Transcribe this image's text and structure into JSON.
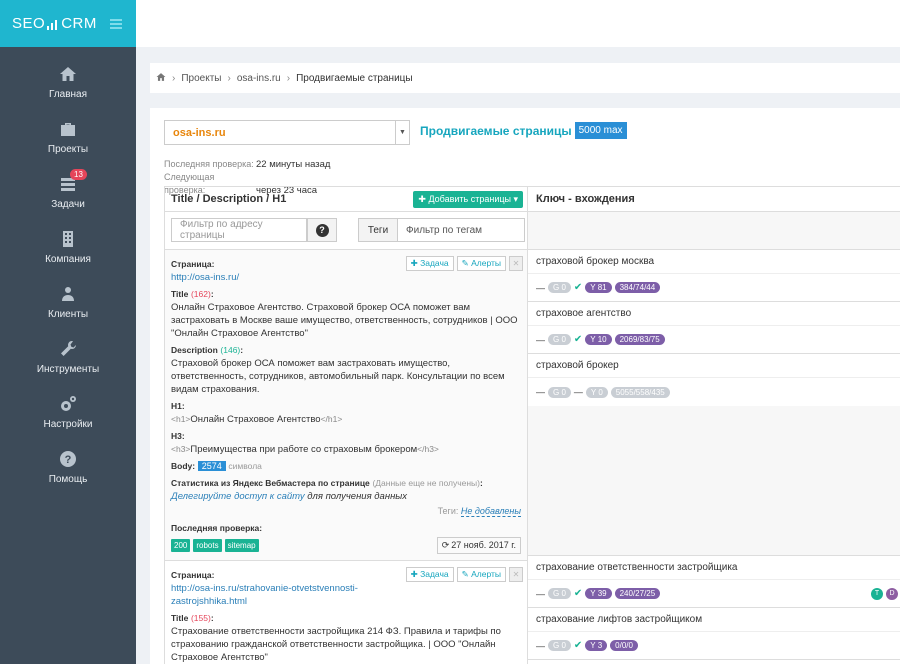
{
  "brand": {
    "logo_left": "SEO",
    "logo_right": "CRM"
  },
  "sidebar": {
    "items": [
      {
        "label": "Главная",
        "icon": "home-icon"
      },
      {
        "label": "Проекты",
        "icon": "briefcase-icon"
      },
      {
        "label": "Задачи",
        "icon": "tasks-icon",
        "badge": "13"
      },
      {
        "label": "Компания",
        "icon": "building-icon"
      },
      {
        "label": "Клиенты",
        "icon": "users-icon"
      },
      {
        "label": "Инструменты",
        "icon": "wrench-icon"
      },
      {
        "label": "Настройки",
        "icon": "gears-icon"
      },
      {
        "label": "Помощь",
        "icon": "question-icon"
      }
    ]
  },
  "breadcrumb": {
    "items": [
      "Проекты",
      "osa-ins.ru",
      "Продвигаемые страницы"
    ]
  },
  "project": {
    "selected": "osa-ins.ru",
    "heading": "Продвигаемые страницы",
    "limit": "5000 max",
    "last_check_label": "Последняя проверка:",
    "last_check_value": "22 минуты назад",
    "next_check_label": "Следующая проверка:",
    "next_check_value": "через 23 часа"
  },
  "left": {
    "header": "Title / Description / H1",
    "add_button": "Добавить страницы",
    "url_filter_placeholder": "Фильтр по адресу страницы",
    "tags_label": "Теги",
    "tags_filter_placeholder": "Фильтр по тегам"
  },
  "actions": {
    "task": "Задача",
    "alerts": "Алерты"
  },
  "page1": {
    "page_label": "Страница:",
    "url": "http://osa-ins.ru/",
    "title_label": "Title",
    "title_count": "(162)",
    "title_text": "Онлайн Страховое Агентство. Страховой брокер ОСА поможет вам застраховать в Москве ваше имущество, ответственность, сотрудников | ООО \"Онлайн Страховое Агентство\"",
    "desc_label": "Description",
    "desc_count": "(146)",
    "desc_text": "Страховой брокер ОСА поможет вам застраховать имущество, ответственность, сотрудников, автомобильный парк. Консультации по всем видам страхования.",
    "h1_label": "H1:",
    "h1_open": "<h1>",
    "h1_text": "Онлайн Страховое Агентство",
    "h1_close": "</h1>",
    "h3_label": "H3:",
    "h3_open": "<h3>",
    "h3_text": "Преимущества при работе со страховым брокером",
    "h3_close": "</h3>",
    "body_label": "Body:",
    "body_count": "2574",
    "body_unit": "символа",
    "webmaster_label": "Статистика из Яндекс Вебмастера по странице",
    "webmaster_note": "(Данные еще не получены)",
    "webmaster_colon": ":",
    "delegate_link": "Делегируйте доступ к сайту",
    "delegate_rest": "для получения данных",
    "tags_prefix": "Теги:",
    "tags_value": "Не добавлены",
    "last_check_label": "Последняя проверка:",
    "status_chips": [
      "200",
      "robots",
      "sitemap"
    ],
    "check_date": "27 нояб. 2017 г."
  },
  "page2": {
    "page_label": "Страница:",
    "url": "http://osa-ins.ru/strahovanie-otvetstvennosti-zastrojshhika.html",
    "url_line1": "http://osa-ins.ru/strahovanie-otvetstvennosti-",
    "url_line2": "zastrojshhika.html",
    "title_label": "Title",
    "title_count": "(155)",
    "title_text": "Страхование ответственности застройщика 214 ФЗ. Правила и тарифы по страхованию гражданской ответственности застройщика. | ООО \"Онлайн Страховое Агентство\""
  },
  "right": {
    "header": "Ключ - вхождения",
    "keywords": [
      {
        "name": "страховой брокер москва",
        "g": "G 0",
        "y": "Y 81",
        "y_checked": true,
        "nums": "384/74/44",
        "nums_gray": false,
        "y_gray": false
      },
      {
        "name": "страховое агентство",
        "g": "G 0",
        "y": "Y 10",
        "y_checked": true,
        "nums": "2069/83/75",
        "nums_gray": false,
        "y_gray": false
      },
      {
        "name": "страховой брокер",
        "g": "G 0",
        "y": "Y 0",
        "y_checked": false,
        "nums": "5055/558/435",
        "nums_gray": true,
        "y_gray": true
      },
      {
        "name": "страхование ответственности застройщика",
        "g": "G 0",
        "y": "Y 39",
        "y_checked": true,
        "nums": "240/27/25",
        "nums_gray": false,
        "y_gray": false,
        "extra": [
          "T",
          "D"
        ]
      },
      {
        "name": "страхование лифтов застройщиком",
        "g": "G 0",
        "y": "Y 3",
        "y_checked": true,
        "nums": "0/0/0",
        "nums_gray": false,
        "y_gray": false
      }
    ],
    "dash": "—"
  }
}
